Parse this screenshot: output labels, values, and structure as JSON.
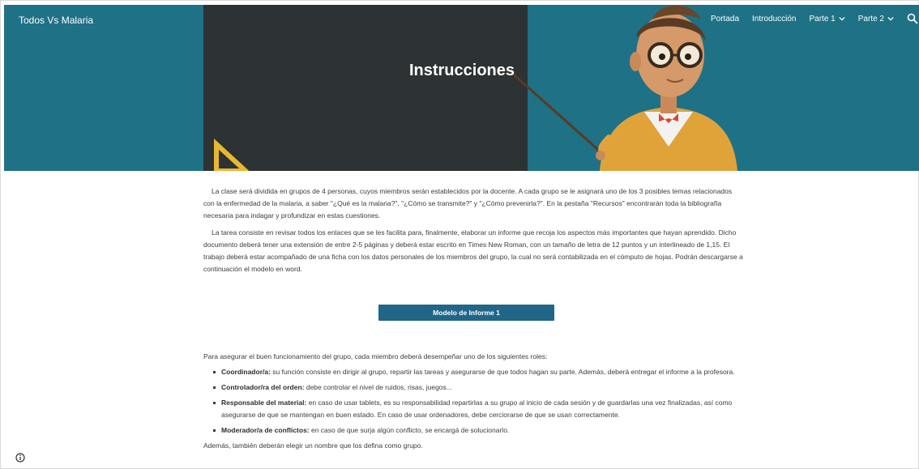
{
  "site": {
    "title": "Todos Vs Malaria"
  },
  "nav": {
    "items": [
      {
        "label": "Portada",
        "dropdown": false
      },
      {
        "label": "Introducción",
        "dropdown": false
      },
      {
        "label": "Parte 1",
        "dropdown": true
      },
      {
        "label": "Parte 2",
        "dropdown": true
      }
    ],
    "search_icon": "search-icon"
  },
  "banner": {
    "title": "Instrucciones"
  },
  "content": {
    "paragraphs": [
      "La clase será dividida en grupos de 4 personas, cuyos miembros serán establecidos por la docente. A cada grupo se le asignará uno de los 3 posibles temas relacionados con la enfermedad de la malaria, a saber \"¿Qué es la malaria?\", \"¿Cómo se transmite?\" y \"¿Cómo prevenirla?\". En la pestaña \"Recursos\" encontrarán toda la bibliografía necesaria para indagar y profundizar en estas cuestiones.",
      "La tarea consiste en revisar todos los enlaces que se les facilita para, finalmente, elaborar un informe que recoja los aspectos más importantes que hayan aprendido. Dicho documento deberá tener una extensión de entre 2-5 páginas y deberá estar escrito en Times New Roman, con un tamaño de letra de 12 puntos y un interlineado de 1,15. El trabajo deberá estar acompañado de una ficha con los datos personales de los miembros del grupo, la cual no será contabilizada en el cómputo de hojas. Podrán descargarse a continuación el modelo en word."
    ],
    "button_label": "Modelo de Informe 1"
  },
  "roles": {
    "intro": "Para asegurar el buen funcionamiento del grupo, cada miembro deberá desempeñar uno de los siguientes roles:",
    "items": [
      {
        "name": "Coordinador/a:",
        "text": " su función consiste en dirigir al grupo, repartir las tareas y asegurarse de que todos hagan su parte. Además, deberá entregar el informe a la profesora."
      },
      {
        "name": "Controlador/ra del orden:",
        "text": " debe controlar el nivel de ruidos, risas, juegos..."
      },
      {
        "name": "Responsable del material:",
        "text": " en caso de usar tablets, es su responsabilidad repartirlas a su grupo al inicio de cada sesión y de guardarlas una vez finalizadas, así como asegurarse de que se mantengan en buen estado. En caso de usar ordenadores, debe cerciorarse de que se usan correctamente."
      },
      {
        "name": "Moderador/a de conflictos:",
        "text": " en caso de que surja algún conflicto, se encargá de solucionarlo."
      }
    ],
    "outro": "Además, también deberán elegir un nombre que los defina como grupo."
  },
  "colors": {
    "banner": "#1f7186",
    "board": "#2d3234",
    "button": "#1f6688"
  }
}
